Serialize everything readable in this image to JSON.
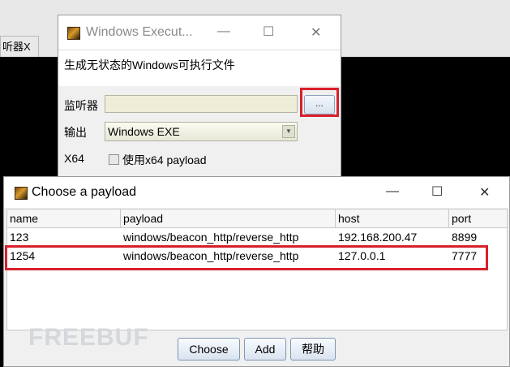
{
  "background": {
    "tab_label": "听器X"
  },
  "exec_dialog": {
    "title": "Windows Execut...",
    "minimize": "—",
    "maximize": "☐",
    "close": "✕",
    "description": "生成无状态的Windows可执行文件",
    "listener_label": "监听器",
    "listener_value": "",
    "browse_button": "...",
    "output_label": "输出",
    "output_value": "Windows EXE",
    "x64_label": "X64",
    "x64_checkbox_label": "使用x64 payload",
    "x64_checked": false
  },
  "payload_dialog": {
    "title": "Choose a payload",
    "minimize": "—",
    "maximize": "☐",
    "close": "✕",
    "columns": [
      "name",
      "payload",
      "host",
      "port"
    ],
    "rows": [
      [
        "123",
        "windows/beacon_http/reverse_http",
        "192.168.200.47",
        "8899"
      ],
      [
        "1254",
        "windows/beacon_http/reverse_http",
        "127.0.0.1",
        "7777"
      ]
    ],
    "buttons": {
      "choose": "Choose",
      "add": "Add",
      "help": "帮助"
    },
    "watermark": "FREEBUF"
  },
  "colors": {
    "highlight_box": "#d8202a",
    "button_border": "#7f96b2"
  }
}
